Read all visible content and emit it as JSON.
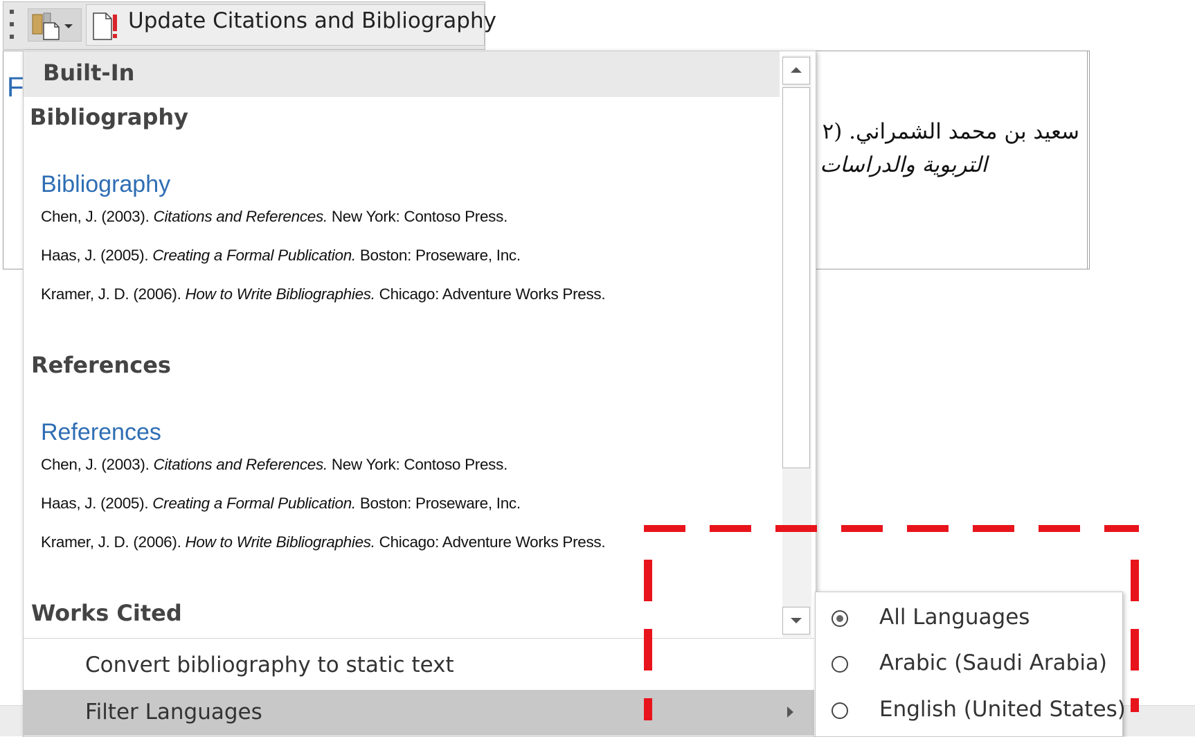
{
  "toolbar": {
    "update_button_label": "Update Citations and Bibliography"
  },
  "document": {
    "partial_heading_letter": "F",
    "arabic_line_1": "سعيد بن محمد الشمراني. (٢",
    "arabic_line_2": "التربوية والدراسات"
  },
  "gallery": {
    "header": "Built-In",
    "sections": [
      {
        "title": "Bibliography",
        "preview_heading": "Bibliography",
        "entries": [
          {
            "pre": "Chen, J. (2003). ",
            "ital": "Citations and References.",
            "post": " New York: Contoso Press."
          },
          {
            "pre": "Haas, J. (2005). ",
            "ital": "Creating a Formal Publication.",
            "post": " Boston: Proseware, Inc."
          },
          {
            "pre": "Kramer, J. D. (2006). ",
            "ital": "How to Write Bibliographies.",
            "post": " Chicago: Adventure Works Press."
          }
        ]
      },
      {
        "title": "References",
        "preview_heading": "References",
        "entries": [
          {
            "pre": "Chen, J. (2003). ",
            "ital": "Citations and References.",
            "post": " New York: Contoso Press."
          },
          {
            "pre": "Haas, J. (2005). ",
            "ital": "Creating a Formal Publication.",
            "post": " Boston: Proseware, Inc."
          },
          {
            "pre": "Kramer, J. D. (2006). ",
            "ital": "How to Write Bibliographies.",
            "post": " Chicago: Adventure Works Press."
          }
        ]
      },
      {
        "title": "Works Cited"
      }
    ]
  },
  "menu": {
    "convert_label": "Convert bibliography to static text",
    "filter_label": "Filter Languages"
  },
  "submenu": {
    "options": [
      {
        "label": "All Languages",
        "selected": true
      },
      {
        "label": "Arabic (Saudi Arabia)",
        "selected": false
      },
      {
        "label": "English (United States)",
        "selected": false
      }
    ]
  },
  "colors": {
    "annotation": "#e8141c",
    "preview_heading": "#2e6db4",
    "hover": "#c8c8c8"
  }
}
